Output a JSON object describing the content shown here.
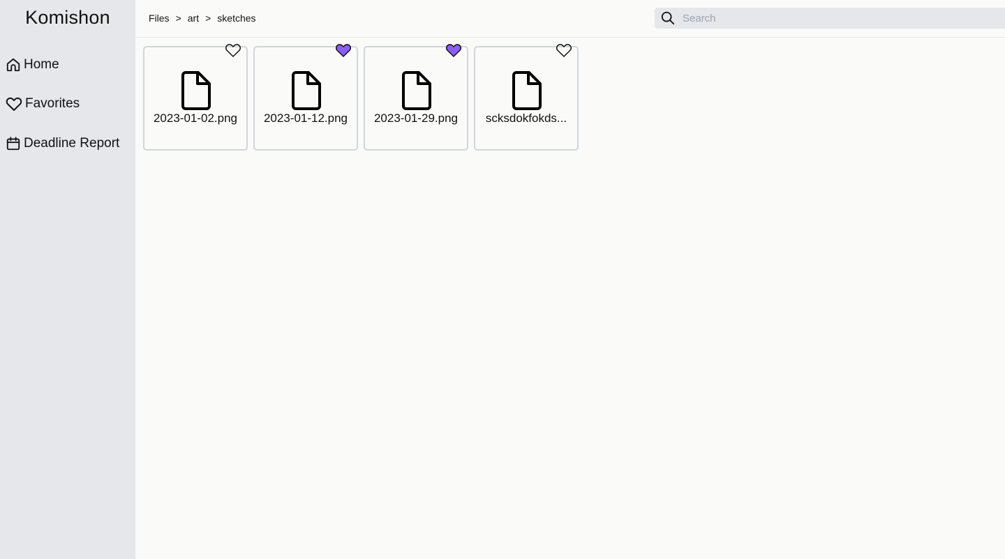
{
  "app": {
    "title": "Komishon"
  },
  "sidebar": {
    "items": [
      {
        "label": "Home",
        "icon": "home-icon"
      },
      {
        "label": "Favorites",
        "icon": "heart-icon"
      },
      {
        "label": "Deadline Report",
        "icon": "calendar-icon"
      }
    ]
  },
  "breadcrumb": {
    "items": [
      "Files",
      "art",
      "sketches"
    ],
    "separator": ">"
  },
  "search": {
    "placeholder": "Search",
    "value": ""
  },
  "files": [
    {
      "name": "2023-01-02.png",
      "favorite": false
    },
    {
      "name": "2023-01-12.png",
      "favorite": true
    },
    {
      "name": "2023-01-29.png",
      "favorite": true
    },
    {
      "name": "scksdokfokds...",
      "favorite": false
    }
  ],
  "colors": {
    "accent": "#8b5cf6",
    "sidebar_bg": "#e5e7eb",
    "page_bg": "#fafaf9",
    "card_border": "#d1d5db"
  }
}
